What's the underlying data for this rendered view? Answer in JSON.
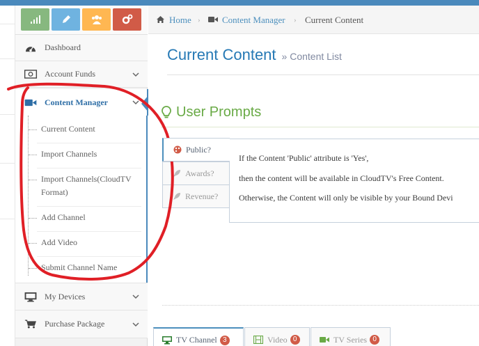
{
  "colors": {
    "topbar": "#4a89bc",
    "success": "#87b87f",
    "info": "#6fb3e0",
    "warning": "#ffb752",
    "danger": "#d15b47",
    "link": "#4c8fbd",
    "green_header": "#69aa46",
    "annotation": "#e01f26"
  },
  "shortcuts": [
    {
      "icon": "signal-icon",
      "color": "#87b87f"
    },
    {
      "icon": "pencil-icon",
      "color": "#6fb3e0"
    },
    {
      "icon": "group-icon",
      "color": "#ffb752"
    },
    {
      "icon": "cogs-icon",
      "color": "#d15b47"
    }
  ],
  "sidebar": {
    "items": [
      {
        "label": "Dashboard",
        "icon": "dashboard-icon"
      },
      {
        "label": "Account Funds",
        "icon": "money-icon"
      },
      {
        "label": "Content Manager",
        "icon": "video-camera-icon",
        "active": true
      },
      {
        "label": "My Devices",
        "icon": "desktop-icon"
      },
      {
        "label": "Purchase Package",
        "icon": "shopping-cart-icon"
      }
    ],
    "submenu": [
      "Current Content",
      "Import Channels",
      "Import Channels(CloudTV Format)",
      "Add Channel",
      "Add Video",
      "Submit Channel Name"
    ]
  },
  "breadcrumbs": {
    "home": "Home",
    "section": "Content Manager",
    "current": "Current Content"
  },
  "page": {
    "title": "Current Content",
    "subtitle": "» Content List"
  },
  "prompts": {
    "heading": "User Prompts",
    "tabs": [
      {
        "label": "Public?",
        "icon": "palette-icon"
      },
      {
        "label": "Awards?",
        "icon": "rocket-icon"
      },
      {
        "label": "Revenue?",
        "icon": "rocket-icon"
      }
    ],
    "lines": [
      "If the Content 'Public' attribute is 'Yes',",
      "then the content will be available in CloudTV's Free Content.",
      "Otherwise, the Content will only be visible by your Bound Devi"
    ]
  },
  "bottom_tabs": [
    {
      "label": "TV Channel",
      "count": "3",
      "icon": "desktop-icon"
    },
    {
      "label": "Video",
      "count": "0",
      "icon": "film-icon"
    },
    {
      "label": "TV Series",
      "count": "0",
      "icon": "video-camera-icon"
    }
  ]
}
